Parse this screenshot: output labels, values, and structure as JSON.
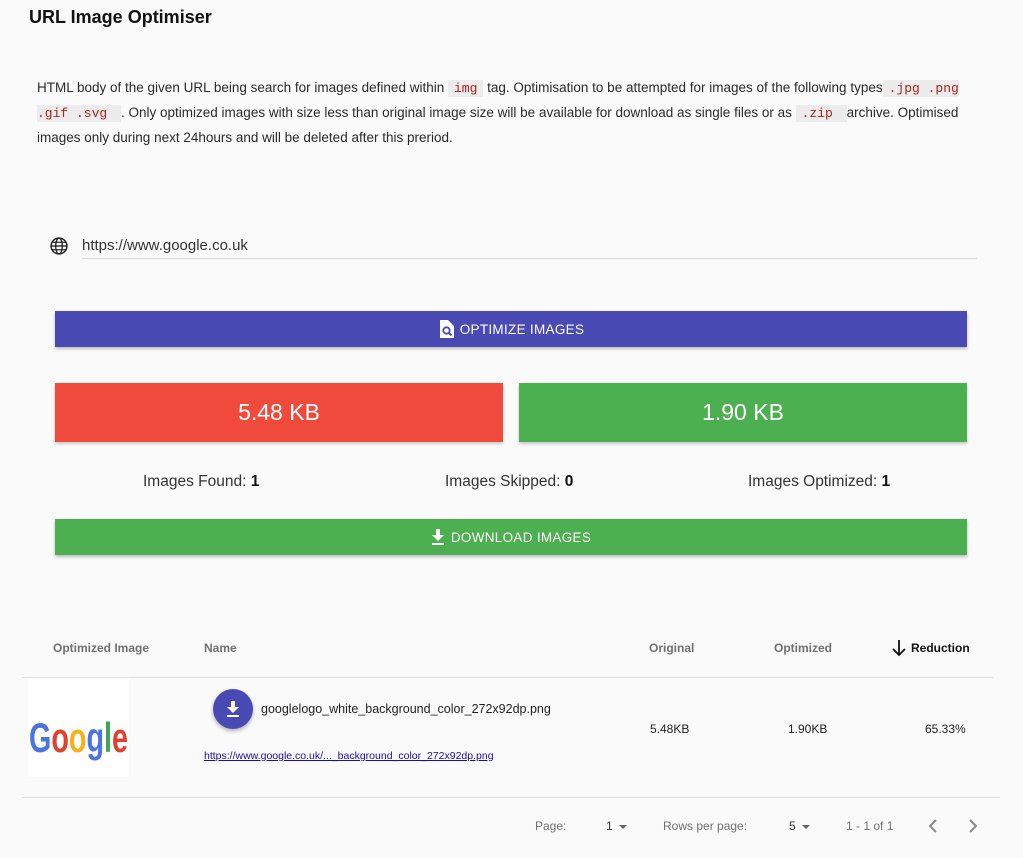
{
  "app": {
    "title": "URL Image Optimiser"
  },
  "description": {
    "p1": "HTML body of the given URL being search for images defined within ",
    "c1": "img",
    "p2": " tag. Optimisation to be attempted for images of the following types",
    "c2": ".jpg .png .gif .svg ",
    "p3": ". Only optimized images with size less than original image size will be available for download as single files or as ",
    "c3": ".zip ",
    "p4": " archive. Optimised images only during next 24hours and will be deleted after this preriod."
  },
  "url_input": {
    "value": "https://www.google.co.uk",
    "icon": "globe-icon"
  },
  "optimize_button": {
    "label": "OPTIMIZE IMAGES",
    "icon": "image-search-icon",
    "color": "#4a4ab5"
  },
  "totals": {
    "original": "5.48 KB",
    "original_color": "#ef4a3c",
    "optimized": "1.90 KB",
    "optimized_color": "#4caf50"
  },
  "stats": {
    "found_label": "Images Found:",
    "found_value": "1",
    "skipped_label": "Images Skipped:",
    "skipped_value": "0",
    "optimized_label": "Images Optimized:",
    "optimized_value": "1"
  },
  "download_button": {
    "label": "DOWNLOAD IMAGES",
    "icon": "download-icon",
    "color": "#4caf50"
  },
  "table": {
    "columns": [
      "Optimized Image",
      "Name",
      "Original",
      "Optimized",
      "Reduction"
    ],
    "sorted_column": "Reduction",
    "rows": [
      {
        "thumbnail": "Google",
        "name": "googlelogo_white_background_color_272x92dp.png",
        "link": "https://www.google.co.uk/..._background_color_272x92dp.png",
        "original": "5.48KB",
        "optimized": "1.90KB",
        "reduction": "65.33%"
      }
    ]
  },
  "pagination": {
    "page_label": "Page:",
    "page_value": "1",
    "rows_label": "Rows per page:",
    "rows_value": "5",
    "range": "1 - 1 of 1"
  }
}
